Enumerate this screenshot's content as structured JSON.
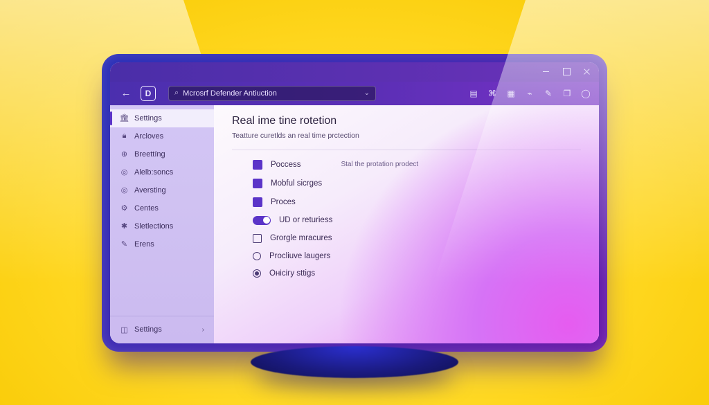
{
  "titlebar": {
    "minimize": "minimize",
    "maximize": "maximize",
    "close": "close"
  },
  "toolbar": {
    "app_letter": "D",
    "search_value": "Mcrosrf Defender Antiuction",
    "icons": [
      "floppy-icon",
      "stamp-icon",
      "grid-icon",
      "tag-icon",
      "pen-icon",
      "window-icon",
      "circle-icon"
    ]
  },
  "sidebar": {
    "items": [
      {
        "icon": "building-icon",
        "label": "Settings",
        "active": true
      },
      {
        "icon": "lock-icon",
        "label": "Arcloves",
        "active": false
      },
      {
        "icon": "globe-icon",
        "label": "Breettíng",
        "active": false
      },
      {
        "icon": "compass-icon",
        "label": "Alelb:soncs",
        "active": false
      },
      {
        "icon": "compass-icon",
        "label": "Aversting",
        "active": false
      },
      {
        "icon": "gear-icon",
        "label": "Centes",
        "active": false
      },
      {
        "icon": "sparkle-icon",
        "label": "Sletlections",
        "active": false
      },
      {
        "icon": "pencil-icon",
        "label": "Erens",
        "active": false
      }
    ],
    "footer_label": "Settings"
  },
  "page": {
    "title": "Real ime tine rotetion",
    "subtitle": "Teatture curetlds an real time prctection",
    "options": [
      {
        "type": "square",
        "label": "Poccess",
        "hint": "Stal the protation prodect"
      },
      {
        "type": "square",
        "label": "Mobful sicrges"
      },
      {
        "type": "square",
        "label": "Proces"
      },
      {
        "type": "toggle",
        "label": "UD or returiess",
        "on": true
      },
      {
        "type": "checkbox",
        "label": "Grorgle mracures",
        "checked": false
      },
      {
        "type": "radio",
        "label": "Procliuve laugers",
        "selected": false
      },
      {
        "type": "radio",
        "label": "Онісігу sttigs",
        "selected": true
      }
    ]
  }
}
